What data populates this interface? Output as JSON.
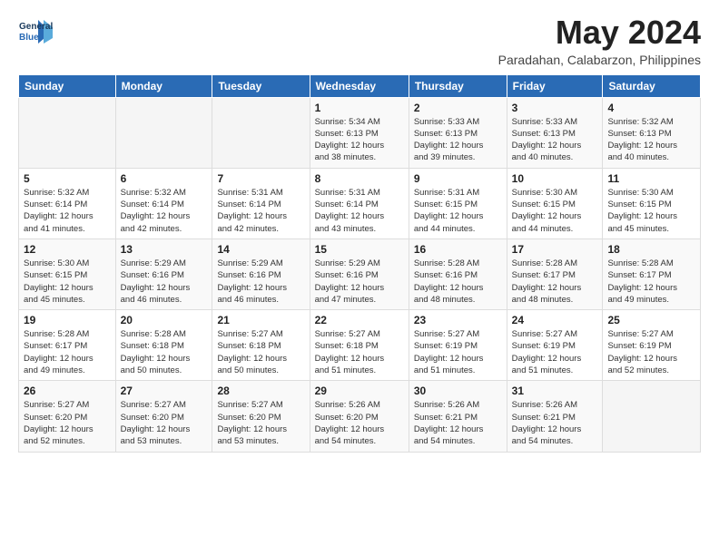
{
  "logo": {
    "line1": "General",
    "line2": "Blue",
    "tagline": ""
  },
  "title": "May 2024",
  "location": "Paradahan, Calabarzon, Philippines",
  "weekdays": [
    "Sunday",
    "Monday",
    "Tuesday",
    "Wednesday",
    "Thursday",
    "Friday",
    "Saturday"
  ],
  "weeks": [
    [
      {
        "day": "",
        "info": ""
      },
      {
        "day": "",
        "info": ""
      },
      {
        "day": "",
        "info": ""
      },
      {
        "day": "1",
        "info": "Sunrise: 5:34 AM\nSunset: 6:13 PM\nDaylight: 12 hours\nand 38 minutes."
      },
      {
        "day": "2",
        "info": "Sunrise: 5:33 AM\nSunset: 6:13 PM\nDaylight: 12 hours\nand 39 minutes."
      },
      {
        "day": "3",
        "info": "Sunrise: 5:33 AM\nSunset: 6:13 PM\nDaylight: 12 hours\nand 40 minutes."
      },
      {
        "day": "4",
        "info": "Sunrise: 5:32 AM\nSunset: 6:13 PM\nDaylight: 12 hours\nand 40 minutes."
      }
    ],
    [
      {
        "day": "5",
        "info": "Sunrise: 5:32 AM\nSunset: 6:14 PM\nDaylight: 12 hours\nand 41 minutes."
      },
      {
        "day": "6",
        "info": "Sunrise: 5:32 AM\nSunset: 6:14 PM\nDaylight: 12 hours\nand 42 minutes."
      },
      {
        "day": "7",
        "info": "Sunrise: 5:31 AM\nSunset: 6:14 PM\nDaylight: 12 hours\nand 42 minutes."
      },
      {
        "day": "8",
        "info": "Sunrise: 5:31 AM\nSunset: 6:14 PM\nDaylight: 12 hours\nand 43 minutes."
      },
      {
        "day": "9",
        "info": "Sunrise: 5:31 AM\nSunset: 6:15 PM\nDaylight: 12 hours\nand 44 minutes."
      },
      {
        "day": "10",
        "info": "Sunrise: 5:30 AM\nSunset: 6:15 PM\nDaylight: 12 hours\nand 44 minutes."
      },
      {
        "day": "11",
        "info": "Sunrise: 5:30 AM\nSunset: 6:15 PM\nDaylight: 12 hours\nand 45 minutes."
      }
    ],
    [
      {
        "day": "12",
        "info": "Sunrise: 5:30 AM\nSunset: 6:15 PM\nDaylight: 12 hours\nand 45 minutes."
      },
      {
        "day": "13",
        "info": "Sunrise: 5:29 AM\nSunset: 6:16 PM\nDaylight: 12 hours\nand 46 minutes."
      },
      {
        "day": "14",
        "info": "Sunrise: 5:29 AM\nSunset: 6:16 PM\nDaylight: 12 hours\nand 46 minutes."
      },
      {
        "day": "15",
        "info": "Sunrise: 5:29 AM\nSunset: 6:16 PM\nDaylight: 12 hours\nand 47 minutes."
      },
      {
        "day": "16",
        "info": "Sunrise: 5:28 AM\nSunset: 6:16 PM\nDaylight: 12 hours\nand 48 minutes."
      },
      {
        "day": "17",
        "info": "Sunrise: 5:28 AM\nSunset: 6:17 PM\nDaylight: 12 hours\nand 48 minutes."
      },
      {
        "day": "18",
        "info": "Sunrise: 5:28 AM\nSunset: 6:17 PM\nDaylight: 12 hours\nand 49 minutes."
      }
    ],
    [
      {
        "day": "19",
        "info": "Sunrise: 5:28 AM\nSunset: 6:17 PM\nDaylight: 12 hours\nand 49 minutes."
      },
      {
        "day": "20",
        "info": "Sunrise: 5:28 AM\nSunset: 6:18 PM\nDaylight: 12 hours\nand 50 minutes."
      },
      {
        "day": "21",
        "info": "Sunrise: 5:27 AM\nSunset: 6:18 PM\nDaylight: 12 hours\nand 50 minutes."
      },
      {
        "day": "22",
        "info": "Sunrise: 5:27 AM\nSunset: 6:18 PM\nDaylight: 12 hours\nand 51 minutes."
      },
      {
        "day": "23",
        "info": "Sunrise: 5:27 AM\nSunset: 6:19 PM\nDaylight: 12 hours\nand 51 minutes."
      },
      {
        "day": "24",
        "info": "Sunrise: 5:27 AM\nSunset: 6:19 PM\nDaylight: 12 hours\nand 51 minutes."
      },
      {
        "day": "25",
        "info": "Sunrise: 5:27 AM\nSunset: 6:19 PM\nDaylight: 12 hours\nand 52 minutes."
      }
    ],
    [
      {
        "day": "26",
        "info": "Sunrise: 5:27 AM\nSunset: 6:20 PM\nDaylight: 12 hours\nand 52 minutes."
      },
      {
        "day": "27",
        "info": "Sunrise: 5:27 AM\nSunset: 6:20 PM\nDaylight: 12 hours\nand 53 minutes."
      },
      {
        "day": "28",
        "info": "Sunrise: 5:27 AM\nSunset: 6:20 PM\nDaylight: 12 hours\nand 53 minutes."
      },
      {
        "day": "29",
        "info": "Sunrise: 5:26 AM\nSunset: 6:20 PM\nDaylight: 12 hours\nand 54 minutes."
      },
      {
        "day": "30",
        "info": "Sunrise: 5:26 AM\nSunset: 6:21 PM\nDaylight: 12 hours\nand 54 minutes."
      },
      {
        "day": "31",
        "info": "Sunrise: 5:26 AM\nSunset: 6:21 PM\nDaylight: 12 hours\nand 54 minutes."
      },
      {
        "day": "",
        "info": ""
      }
    ]
  ]
}
